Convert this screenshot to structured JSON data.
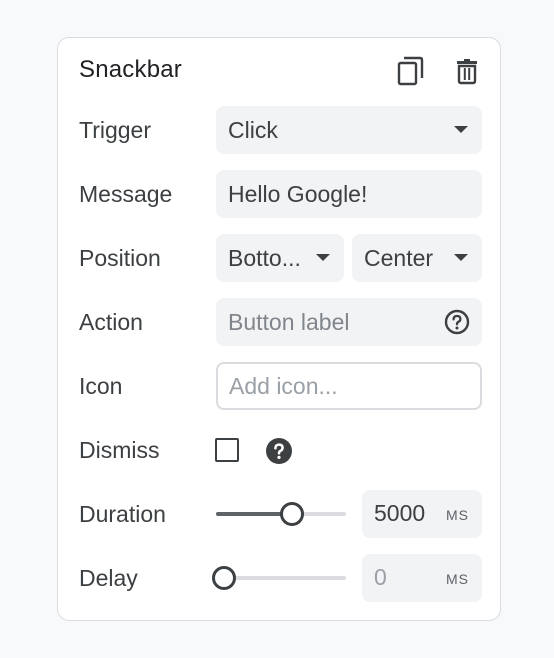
{
  "panel": {
    "title": "Snackbar",
    "duplicate_icon": "copy-icon",
    "delete_icon": "trash-icon"
  },
  "rows": {
    "trigger": {
      "label": "Trigger",
      "value": "Click"
    },
    "message": {
      "label": "Message",
      "value": "Hello Google!"
    },
    "position": {
      "label": "Position",
      "vertical": "Botto...",
      "horizontal": "Center"
    },
    "action": {
      "label": "Action",
      "placeholder": "Button label",
      "help_icon": "help-outline-icon"
    },
    "icon": {
      "label": "Icon",
      "placeholder": "Add icon..."
    },
    "dismiss": {
      "label": "Dismiss",
      "checked": false,
      "help_icon": "help-filled-icon"
    },
    "duration": {
      "label": "Duration",
      "value": "5000",
      "unit": "MS",
      "slider_fraction": 0.6
    },
    "delay": {
      "label": "Delay",
      "value": "0",
      "unit": "MS",
      "slider_fraction": 0
    }
  },
  "colors": {
    "field_bg": "#f1f3f4",
    "text": "#3c4043",
    "border": "#dadce0"
  }
}
